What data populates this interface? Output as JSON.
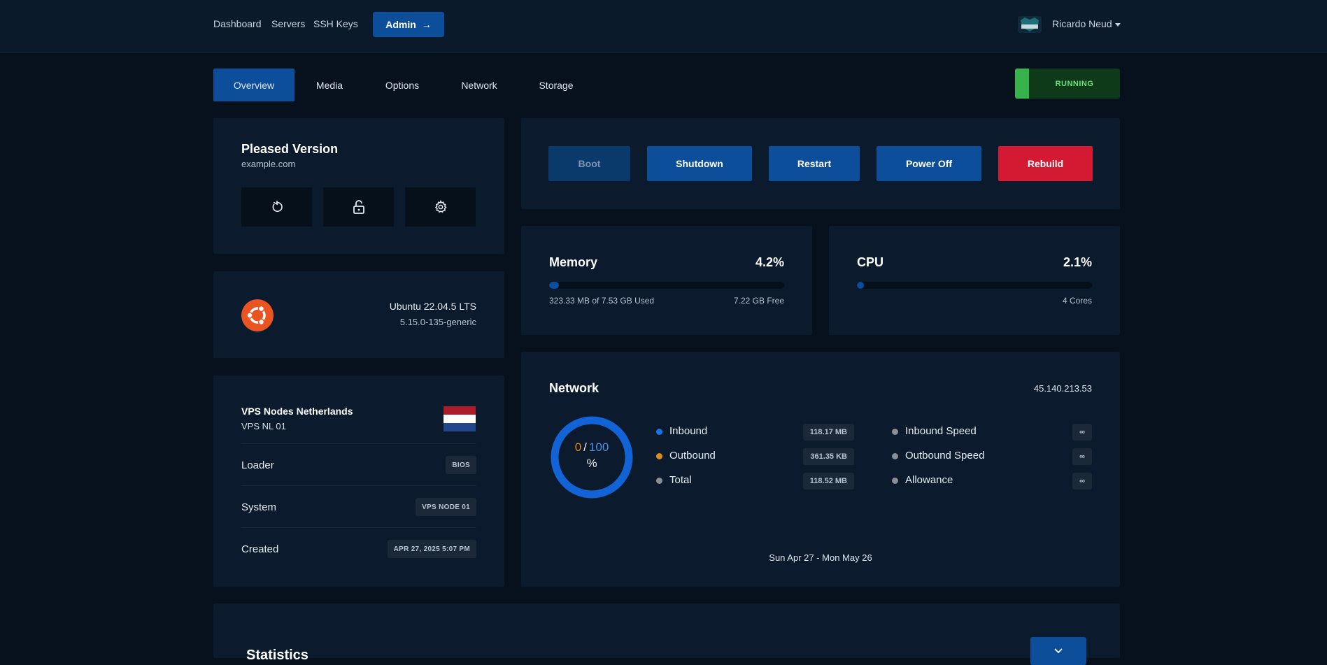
{
  "nav": {
    "items": [
      "Dashboard",
      "Servers",
      "SSH Keys"
    ],
    "admin_label": "Admin",
    "admin_arrow": "→",
    "user_name": "Ricardo Neud"
  },
  "tabs": [
    "Overview",
    "Media",
    "Options",
    "Network",
    "Storage"
  ],
  "active_tab": "Overview",
  "status": {
    "label": "RUNNING",
    "color": "#36b34a"
  },
  "server": {
    "name": "Pleased Version",
    "hostname": "example.com",
    "quick_actions": [
      "reinstall-icon",
      "lock-icon",
      "gear-icon"
    ]
  },
  "os": {
    "name": "Ubuntu 22.04.5 LTS",
    "kernel": "5.15.0-135-generic",
    "icon": "ubuntu-logo"
  },
  "location": {
    "name": "VPS Nodes Netherlands",
    "node": "VPS NL 01",
    "flag": "netherlands-flag",
    "rows": [
      {
        "label": "Loader",
        "value": "BIOS"
      },
      {
        "label": "System",
        "value": "VPS NODE 01"
      },
      {
        "label": "Created",
        "value": "APR 27, 2025 5:07 PM"
      }
    ]
  },
  "power": {
    "boot": "Boot",
    "shutdown": "Shutdown",
    "restart": "Restart",
    "power_off": "Power Off",
    "rebuild": "Rebuild"
  },
  "memory": {
    "title": "Memory",
    "percent_label": "4.2%",
    "percent": 4.2,
    "used_label": "323.33 MB of 7.53 GB Used",
    "free_label": "7.22 GB Free"
  },
  "cpu": {
    "title": "CPU",
    "percent_label": "2.1%",
    "percent": 2.1,
    "cores_label": "4 Cores"
  },
  "network": {
    "title": "Network",
    "ip": "45.140.213.53",
    "usage_current": "0",
    "usage_separator": "/",
    "usage_max": "100",
    "usage_unit": "%",
    "stats_left": [
      {
        "label": "Inbound",
        "value": "118.17 MB",
        "color": "#1a73e8"
      },
      {
        "label": "Outbound",
        "value": "361.35 KB",
        "color": "#e08a1e"
      },
      {
        "label": "Total",
        "value": "118.52 MB",
        "color": "#8a8f96"
      }
    ],
    "stats_right": [
      {
        "label": "Inbound Speed",
        "value": "∞",
        "color": "#8a8f96"
      },
      {
        "label": "Outbound Speed",
        "value": "∞",
        "color": "#8a8f96"
      },
      {
        "label": "Allowance",
        "value": "∞",
        "color": "#8a8f96"
      }
    ],
    "date_range": "Sun Apr 27 - Mon May 26"
  },
  "statistics": {
    "title": "Statistics",
    "toggle_icon": "chevron-down-icon"
  }
}
